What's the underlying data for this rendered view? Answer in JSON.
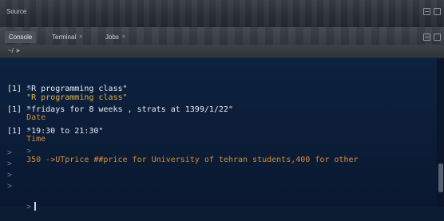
{
  "source": {
    "title": "Source"
  },
  "tabs": [
    {
      "label": "Console",
      "active": true
    },
    {
      "label": "Terminal"
    },
    {
      "label": "Jobs"
    }
  ],
  "console_toolbar": {
    "path": "~/"
  },
  "console": {
    "lines": [
      {
        "prompt": ">",
        "text": "\"R programming class\"",
        "kind": "input"
      },
      {
        "prompt": "",
        "text": "[1] \"R programming class\"",
        "kind": "output"
      },
      {
        "prompt": ">",
        "text": "Date",
        "kind": "input"
      },
      {
        "prompt": "",
        "text": "[1] \"fridays for 8 weeks , strats at 1399/1/22\"",
        "kind": "output"
      },
      {
        "prompt": ">",
        "text": "Time",
        "kind": "input"
      },
      {
        "prompt": "",
        "text": "[1] \"19:30 to 21:30\"",
        "kind": "output"
      },
      {
        "prompt": ">",
        "text": "350 ->UTprice ##price for University of tehran students,400 for other",
        "kind": "input"
      },
      {
        "prompt": ">",
        "text": "",
        "kind": "empty"
      },
      {
        "prompt": ">",
        "text": "",
        "kind": "empty"
      },
      {
        "prompt": ">",
        "text": "",
        "kind": "empty"
      },
      {
        "prompt": ">",
        "text": "",
        "kind": "empty"
      },
      {
        "prompt": ">",
        "text": "",
        "kind": "cursor"
      }
    ]
  },
  "colors": {
    "background": "#0c1c33",
    "input_text": "#e5b04a",
    "output_text": "#e8ecf2",
    "prompt": "#5c78a2"
  }
}
